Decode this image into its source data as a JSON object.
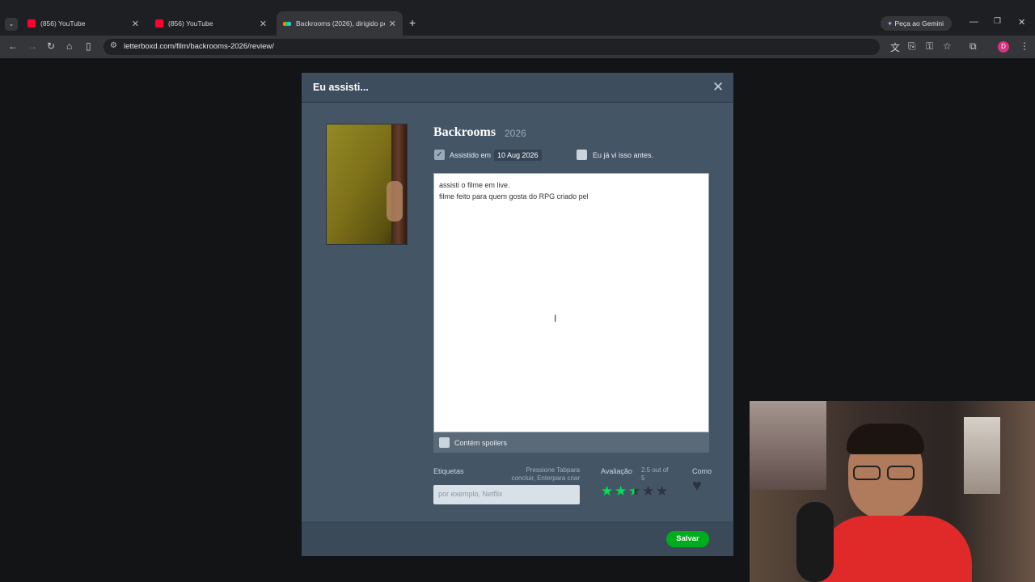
{
  "browser": {
    "tabs": [
      {
        "title": "(856) YouTube"
      },
      {
        "title": "(856) YouTube"
      },
      {
        "title": "Backrooms (2026), dirigido por"
      }
    ],
    "gemini_label": "Peça ao Gemini",
    "url": "letterboxd.com/film/backrooms-2026/review/",
    "profile_initial": "D"
  },
  "modal": {
    "title": "Eu assisti...",
    "film_title": "Backrooms",
    "film_year": "2026",
    "watched_on_label": "Assistido em",
    "watched_date": "10 Aug 2026",
    "rewatch_label": "Eu já vi isso antes.",
    "review_lines": [
      "assisti o filme em live.",
      "filme feito para quem gosta do RPG criado pel"
    ],
    "spoiler_label": "Contém spoilers",
    "tags_label": "Etiquetas",
    "tags_hint_1": "Pressione Tabpara",
    "tags_hint_2": "concluir, Enterpara criar",
    "tags_placeholder": "por exemplo, Netflix",
    "rating_label": "Avaliação",
    "rating_text_1": "2.5 out of",
    "rating_text_2": "5",
    "rating_value": 2.5,
    "rating_max": 5,
    "like_label": "Como",
    "save_label": "Salvar"
  },
  "colors": {
    "accent_green": "#00ac1c",
    "star_green": "#00e054",
    "modal_bg": "#445566"
  }
}
